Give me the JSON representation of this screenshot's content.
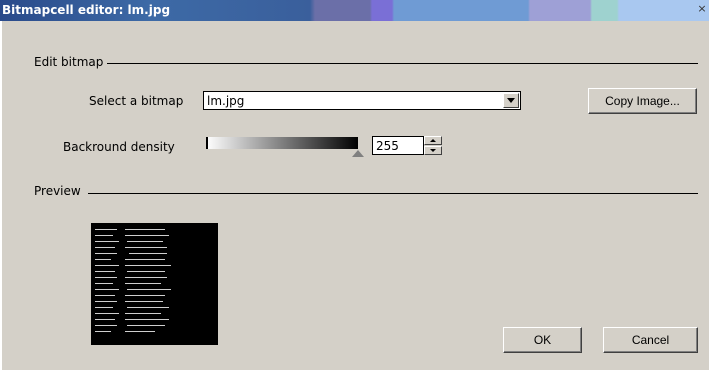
{
  "window": {
    "title": "Bitmapcell editor: lm.jpg",
    "close_glyph": "×"
  },
  "edit_section": {
    "label": "Edit bitmap",
    "select_label": "Select a bitmap",
    "selected_bitmap": "lm.jpg",
    "copy_button": "Copy Image...",
    "density_label": "Backround density",
    "density_value": "255"
  },
  "preview_section": {
    "label": "Preview"
  },
  "buttons": {
    "ok": "OK",
    "cancel": "Cancel"
  },
  "icons": {
    "dropdown": "chevron-down-icon",
    "spin_up": "spin-up-icon",
    "spin_down": "spin-down-icon"
  }
}
